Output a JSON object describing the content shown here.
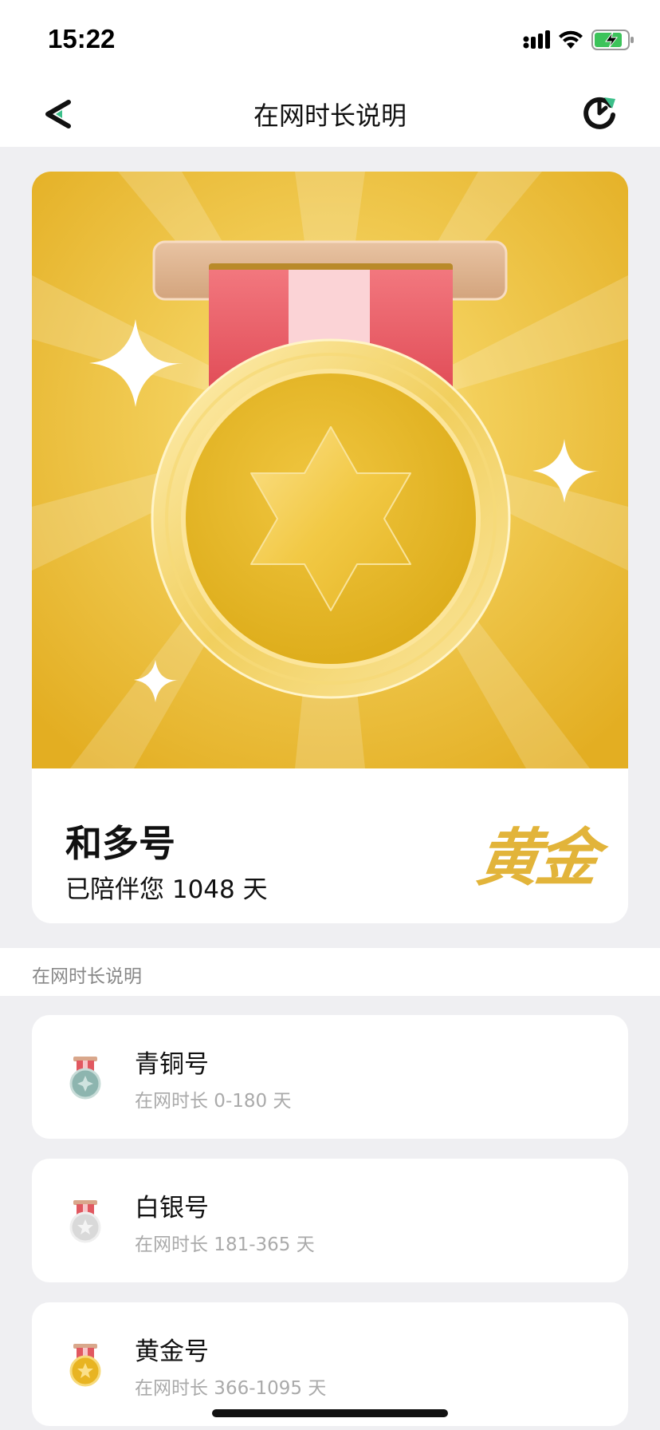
{
  "status_bar": {
    "time": "15:22"
  },
  "nav": {
    "title": "在网时长说明"
  },
  "hero": {
    "level_name": "和多号",
    "accompany_text": "已陪伴您 1048 天",
    "badge_text": "黄金"
  },
  "section": {
    "label": "在网时长说明"
  },
  "tiers": [
    {
      "name": "青铜号",
      "range": "在网时长 0-180 天",
      "medal_color": "#7fa9a3"
    },
    {
      "name": "白银号",
      "range": "在网时长 181-365 天",
      "medal_color": "#d8d8d8"
    },
    {
      "name": "黄金号",
      "range": "在网时长 366-1095 天",
      "medal_color": "#e8b422"
    }
  ],
  "colors": {
    "accent_green": "#3cbf8a",
    "gold": "#e2b43a",
    "hero_background": "#e6b52a"
  }
}
